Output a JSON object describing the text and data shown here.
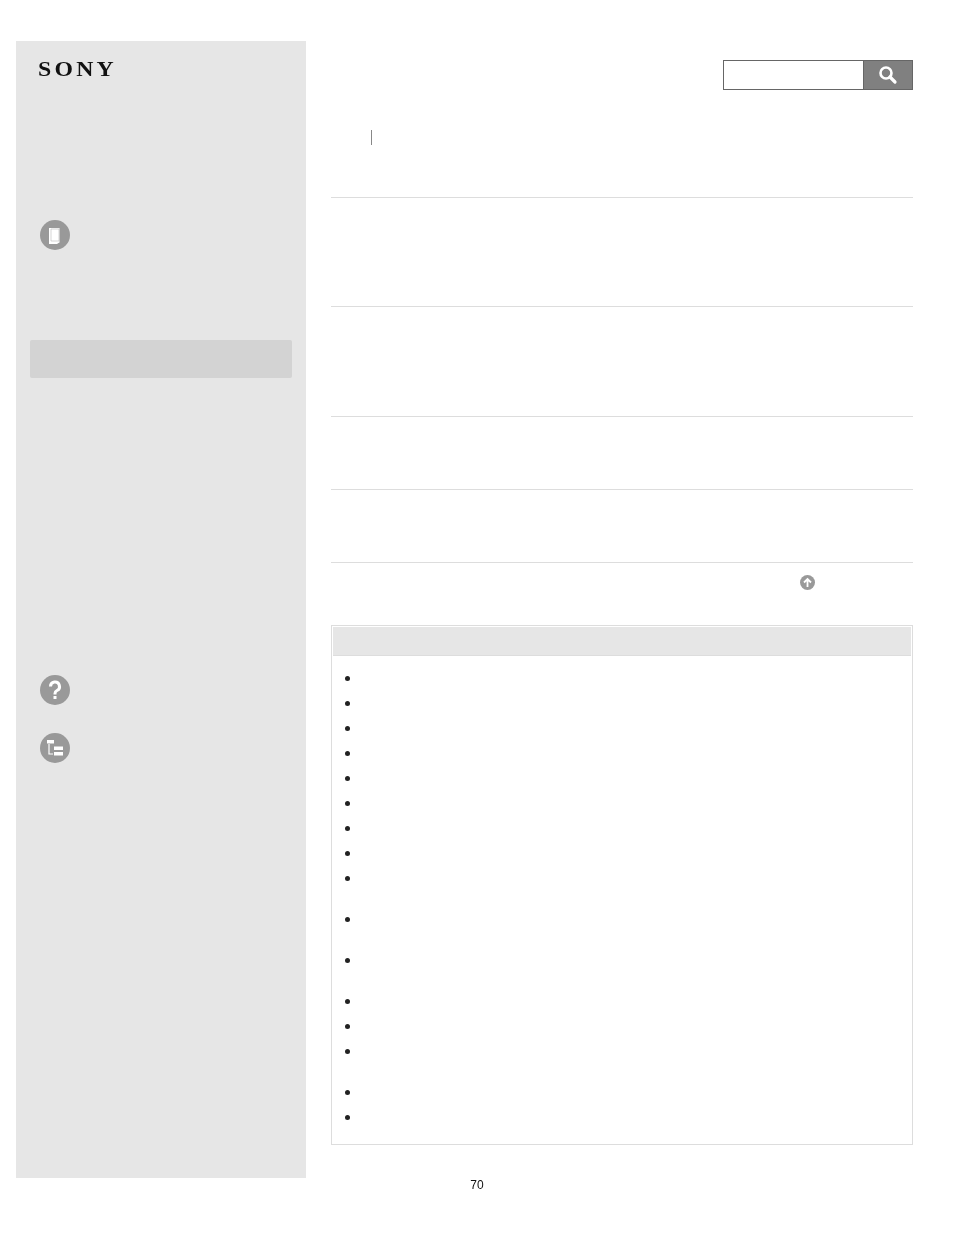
{
  "logo": "SONY",
  "sidebar": {
    "nav_highlight": true
  },
  "list_items": [
    {
      "kind": "single"
    },
    {
      "kind": "single"
    },
    {
      "kind": "single"
    },
    {
      "kind": "single"
    },
    {
      "kind": "single"
    },
    {
      "kind": "single"
    },
    {
      "kind": "single"
    },
    {
      "kind": "single"
    },
    {
      "kind": "double"
    },
    {
      "kind": "double"
    },
    {
      "kind": "double"
    },
    {
      "kind": "single"
    },
    {
      "kind": "single"
    },
    {
      "kind": "double"
    },
    {
      "kind": "single"
    },
    {
      "kind": "single"
    }
  ],
  "page_number": "70"
}
